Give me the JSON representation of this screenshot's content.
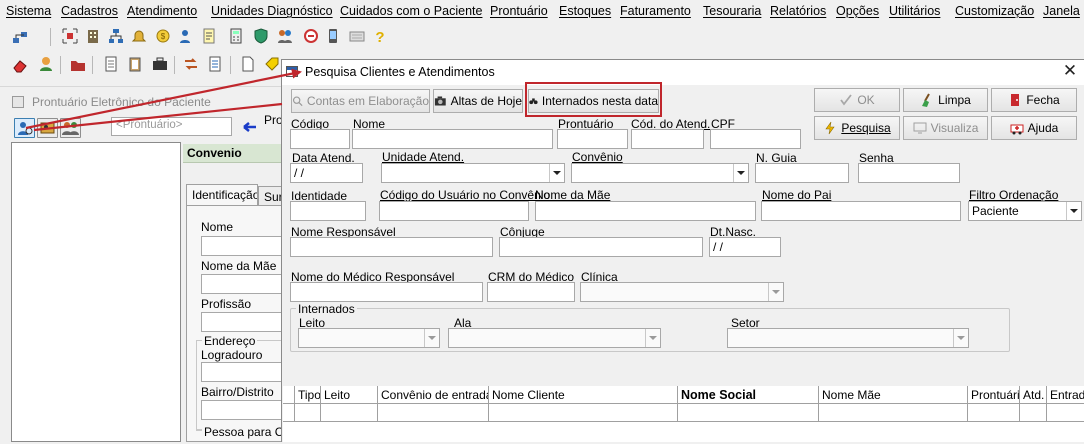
{
  "menu": [
    "Sistema",
    "Cadastros",
    "Atendimento",
    "Unidades Diagnóstico",
    "Cuidados com o Paciente",
    "Prontuário",
    "Estoques",
    "Faturamento",
    "Tesouraria",
    "Relatórios",
    "Opções",
    "Utilitários",
    "Customização",
    "Janela"
  ],
  "background_window": {
    "title": "Prontuário Eletrônico do Paciente",
    "prontuario_placeholder": "<Prontuário>",
    "label_pro": "Pro",
    "convenio_header": "Convenio",
    "tabs": [
      "Identificação",
      "Sur"
    ],
    "fields": {
      "nome": "Nome",
      "nome_mae": "Nome da Mãe",
      "profissao": "Profissão",
      "endereco": "Endereço",
      "logradouro": "Logradouro",
      "bairro": "Bairro/Distrito",
      "pessoa_contato": "Pessoa para Co"
    }
  },
  "dialog": {
    "title": "Pesquisa Clientes e Atendimentos",
    "buttons": {
      "contas": "Contas em Elaboração",
      "altas": "Altas de Hoje",
      "internados": "Internados nesta data",
      "ok": "OK",
      "limpa": "Limpa",
      "fecha": "Fecha",
      "pesquisa": "Pesquisa",
      "visualiza": "Visualiza",
      "ajuda": "Ajuda"
    },
    "labels": {
      "codigo": "Código",
      "nome": "Nome",
      "prontuario": "Prontuário",
      "cod_atend": "Cód. do Atend.",
      "cpf": "CPF",
      "data_atend": "Data Atend.",
      "unidade_atend": "Unidade Atend.",
      "convenio": "Convênio",
      "n_guia": "N. Guia",
      "senha": "Senha",
      "identidade": "Identidade",
      "codigo_usuario": "Código do Usuário no Convênio",
      "nome_mae": "Nome da Mãe",
      "nome_pai": "Nome do Pai",
      "filtro_ordenacao": "Filtro Ordenação",
      "nome_responsavel": "Nome Responsável",
      "conjuge": "Cônjuge",
      "dt_nasc": "Dt.Nasc.",
      "nome_medico": "Nome do Médico Responsável",
      "crm_medico": "CRM do Médico",
      "clinica": "Clínica",
      "internados": "Internados",
      "leito": "Leito",
      "ala": "Ala",
      "setor": "Setor"
    },
    "values": {
      "data_atend": " / /",
      "dt_nasc": " / /",
      "filtro_ordenacao": "Paciente"
    },
    "grid_columns": [
      "Tipo",
      "Leito",
      "Convênio de entrada",
      "Nome Cliente",
      "Nome Social",
      "Nome Mãe",
      "Prontuário",
      "Atd.",
      "Entrad"
    ]
  },
  "colors": {
    "highlight": "#c0262c",
    "convenio_header_bg": "#d8e6d2"
  }
}
